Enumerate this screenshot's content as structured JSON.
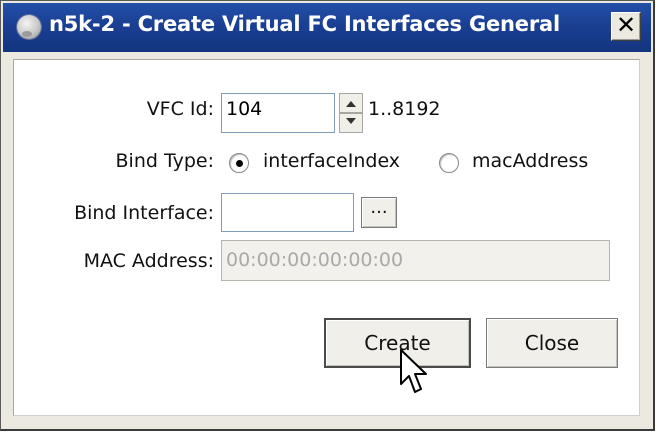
{
  "window": {
    "title": "n5k-2 - Create Virtual FC Interfaces General",
    "close_glyph": "✕"
  },
  "form": {
    "vfc_id": {
      "label": "VFC Id:",
      "value": "104",
      "range": "1..8192"
    },
    "bind_type": {
      "label": "Bind Type:",
      "options": [
        {
          "label": "interfaceIndex",
          "selected": true
        },
        {
          "label": "macAddress",
          "selected": false
        }
      ]
    },
    "bind_interface": {
      "label": "Bind Interface:",
      "value": "",
      "browse_label": "..."
    },
    "mac_address": {
      "label": "MAC Address:",
      "value": "00:00:00:00:00:00",
      "disabled": true
    }
  },
  "buttons": {
    "create": "Create",
    "close": "Close"
  },
  "colors": {
    "titlebar": "#1a3f93",
    "window_bg": "#ece9e0",
    "field_border": "#7f9db9"
  },
  "icons": {
    "app": "app-globe-icon",
    "close": "close-icon",
    "spin_up": "spin-up-icon",
    "spin_down": "spin-down-icon",
    "cursor": "mouse-pointer-icon"
  }
}
